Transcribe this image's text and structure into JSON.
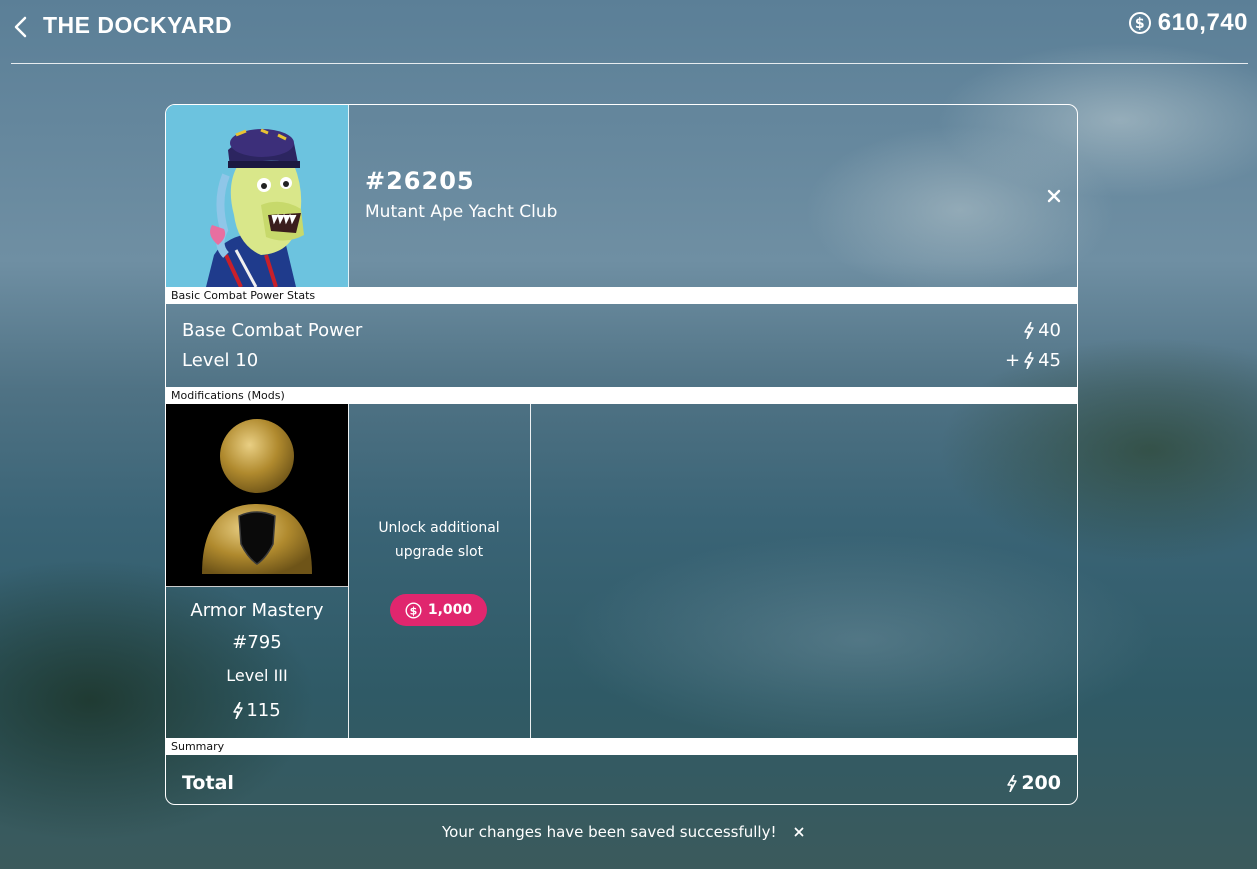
{
  "header": {
    "title": "THE DOCKYARD",
    "balance": "610,740"
  },
  "nft": {
    "id": "#26205",
    "collection": "Mutant Ape Yacht Club"
  },
  "sections": {
    "basic_stats": "Basic Combat Power Stats",
    "mods": "Modifications (Mods)",
    "summary": "Summary"
  },
  "stats": [
    {
      "label": "Base Combat Power",
      "prefix": "",
      "value": "40"
    },
    {
      "label": "Level 10",
      "prefix": "+",
      "value": "45"
    }
  ],
  "mod": {
    "name": "Armor Mastery",
    "id": "#795",
    "level": "Level III",
    "power": "115"
  },
  "unlock": {
    "line1": "Unlock additional",
    "line2": "upgrade slot",
    "price": "1,000"
  },
  "summary": {
    "label": "Total",
    "value": "200"
  },
  "toast": {
    "message": "Your changes have been saved successfully!"
  },
  "colors": {
    "accent_pink": "#e0266e",
    "nft_bg": "#6cc3df",
    "mod_gold": "#b08a2e"
  }
}
